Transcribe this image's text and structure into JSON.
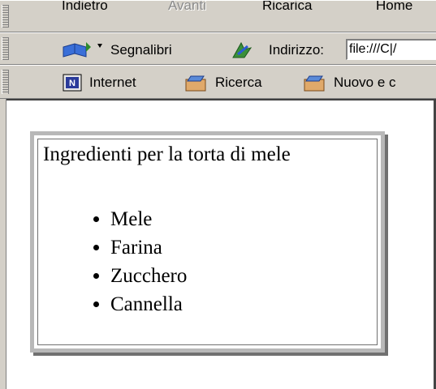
{
  "navbar": {
    "back": "Indietro",
    "forward": "Avanti",
    "reload": "Ricarica",
    "home": "Home"
  },
  "toolbar": {
    "bookmarks": "Segnalibri",
    "address_label": "Indirizzo:",
    "address_value": "file:///C|/"
  },
  "personal_toolbar": {
    "items": [
      {
        "label": "Internet",
        "icon": "netscape-icon"
      },
      {
        "label": "Ricerca",
        "icon": "folder-icon"
      },
      {
        "label": "Nuovo e c",
        "icon": "folder-icon"
      }
    ]
  },
  "page": {
    "heading": "Ingredienti per la torta di mele",
    "ingredients": [
      "Mele",
      "Farina",
      "Zucchero",
      "Cannella"
    ]
  }
}
